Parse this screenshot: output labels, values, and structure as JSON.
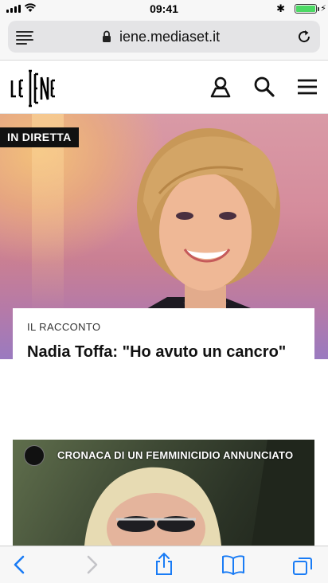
{
  "status_bar": {
    "time": "09:41",
    "battery_level": 1.0,
    "bluetooth_icon": "bluetooth-icon",
    "charging_icon": "bolt-icon"
  },
  "browser": {
    "url": "iene.mediaset.it",
    "icons": [
      "reader-menu-icon",
      "lock-icon",
      "reload-icon"
    ]
  },
  "site_header": {
    "logo_text": "LE IENE",
    "icons": [
      "user-icon",
      "search-icon",
      "hamburger-menu-icon"
    ]
  },
  "hero": {
    "badge": "IN DIRETTA",
    "kicker": "IL RACCONTO",
    "headline": "Nadia Toffa: \"Ho avuto un cancro\""
  },
  "article2": {
    "banner": "CRONACA DI UN FEMMINICIDIO ANNUNCIATO"
  },
  "toolbar": {
    "icons": [
      "back-icon",
      "forward-icon",
      "share-icon",
      "bookmarks-icon",
      "tabs-icon"
    ]
  },
  "colors": {
    "accent_blue": "#1a7cf5",
    "badge_bg": "#111111",
    "battery_green": "#4cd964"
  }
}
